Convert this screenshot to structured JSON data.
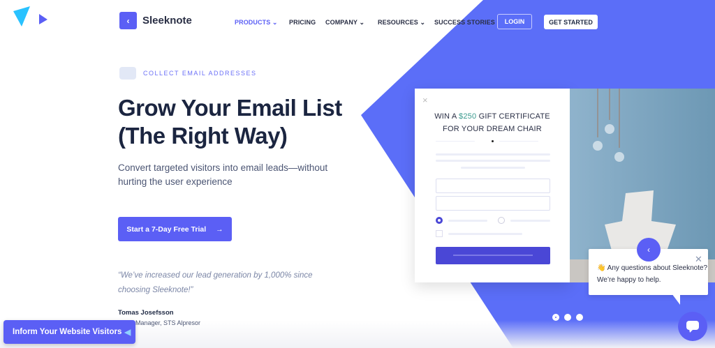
{
  "colors": {
    "brand": "#5b5ff5",
    "dark": "#1b2540",
    "accent_green": "#3a9a8e"
  },
  "nav": {
    "brand": "Sleeknote",
    "items": [
      "PRODUCTS",
      "PRICING",
      "COMPANY",
      "RESOURCES",
      "SUCCESS STORIES"
    ],
    "login": "LOGIN",
    "get_started": "GET STARTED"
  },
  "hero": {
    "eyebrow": "COLLECT EMAIL ADDRESSES",
    "title_line1": "Grow Your Email List",
    "title_line2": "(The Right Way)",
    "subtitle": "Convert targeted visitors into email leads—without hurting the user experience",
    "cta": "Start a 7-Day Free Trial",
    "cta_arrow": "→"
  },
  "testimonial": {
    "quote": "“We’ve increased our lead generation by 1,000% since choosing Sleeknote!”",
    "name": "Tomas Josefsson",
    "role": "Sales Manager, STS Alpresor"
  },
  "inform": {
    "label": "Inform Your Website Visitors",
    "icon": "megaphone-icon"
  },
  "popup": {
    "close": "×",
    "title_pre": "WIN A ",
    "amount": "$250",
    "title_post": " GIFT CERTIFICATE",
    "title_line2": "FOR YOUR DREAM CHAIR"
  },
  "chat": {
    "message": "👋 Any questions about Sleeknote? We’re happy to help.",
    "close": "✕"
  },
  "carousel": {
    "count": 3,
    "active": 0
  }
}
